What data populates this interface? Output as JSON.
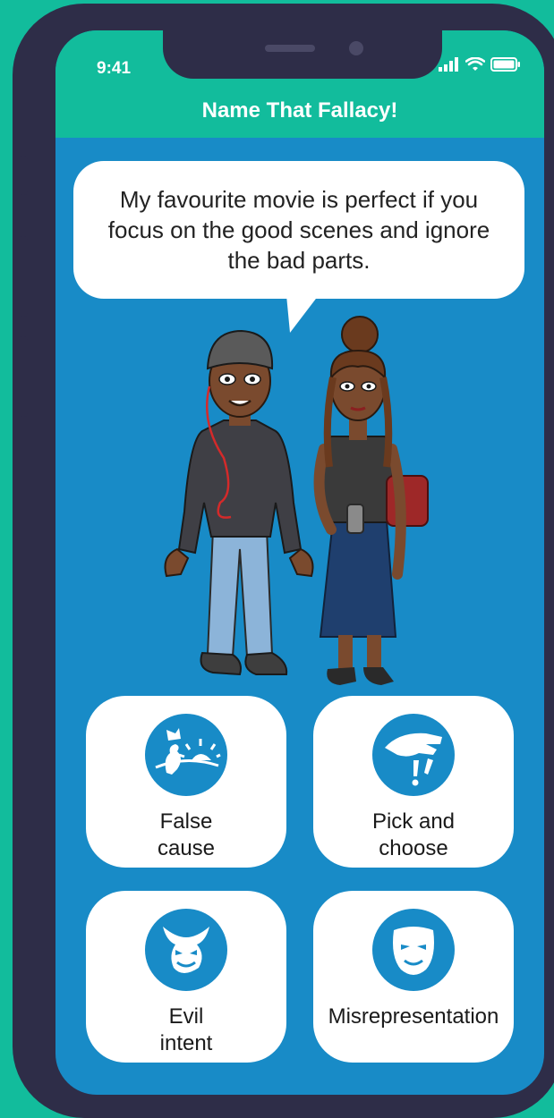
{
  "status_bar": {
    "time": "9:41"
  },
  "header": {
    "title": "Name That Fallacy!"
  },
  "speech_bubble": {
    "text": "My favourite movie is perfect if you focus on the good scenes and ignore the bad parts."
  },
  "options": [
    {
      "label": "False\ncause",
      "icon": "rooster-sunrise-icon"
    },
    {
      "label": "Pick and\nchoose",
      "icon": "picking-hand-icon"
    },
    {
      "label": "Evil\nintent",
      "icon": "devil-face-icon"
    },
    {
      "label": "Misrepresentation",
      "icon": "mask-icon"
    }
  ],
  "colors": {
    "background": "#12bc9c",
    "phone_frame": "#2e2d48",
    "screen": "#188bc7",
    "accent": "#12bc9c",
    "card": "#ffffff"
  }
}
